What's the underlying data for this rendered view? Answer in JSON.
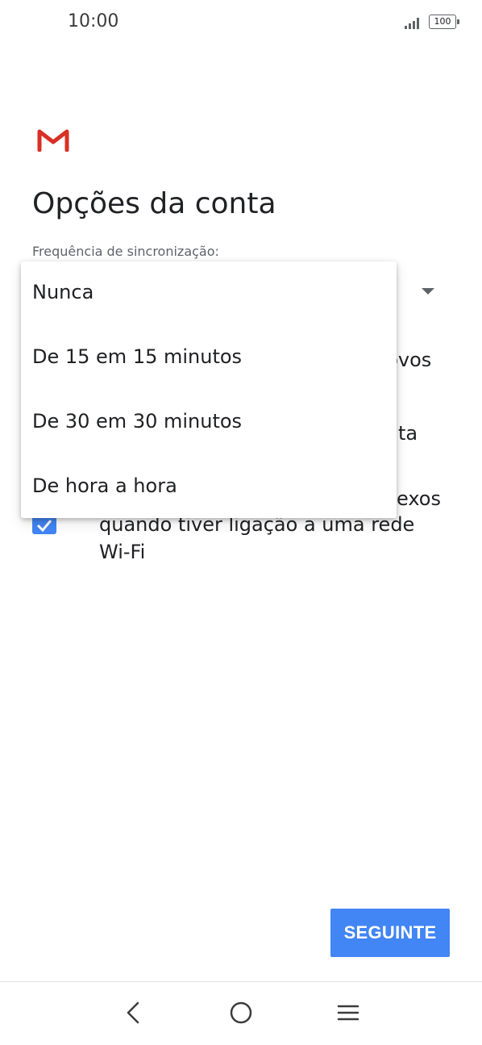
{
  "status_bar": {
    "time": "10:00",
    "battery": "100"
  },
  "page": {
    "title": "Opções da conta",
    "sync_frequency_label": "Frequência de sincronização:"
  },
  "background_options": {
    "option1_visible_end": "novos",
    "option2_visible_end": "ta",
    "option3_visible_end": "exos",
    "option3_line2": "quando tiver ligação a uma rede",
    "option3_line3": "Wi-Fi"
  },
  "dropdown": {
    "options": [
      {
        "label": "Nunca"
      },
      {
        "label": "De 15 em 15 minutos"
      },
      {
        "label": "De 30 em 30 minutos"
      },
      {
        "label": "De hora a hora"
      }
    ]
  },
  "footer": {
    "next_button_label": "SEGUINTE"
  },
  "colors": {
    "accent": "#4285f4",
    "gmail_red": "#d93025"
  },
  "icons": {
    "logo": "gmail-logo-icon",
    "back": "back-chevron-icon",
    "home": "home-circle-icon",
    "menu": "menu-lines-icon",
    "dropdown": "dropdown-arrow-icon",
    "checkbox": "check-icon"
  }
}
